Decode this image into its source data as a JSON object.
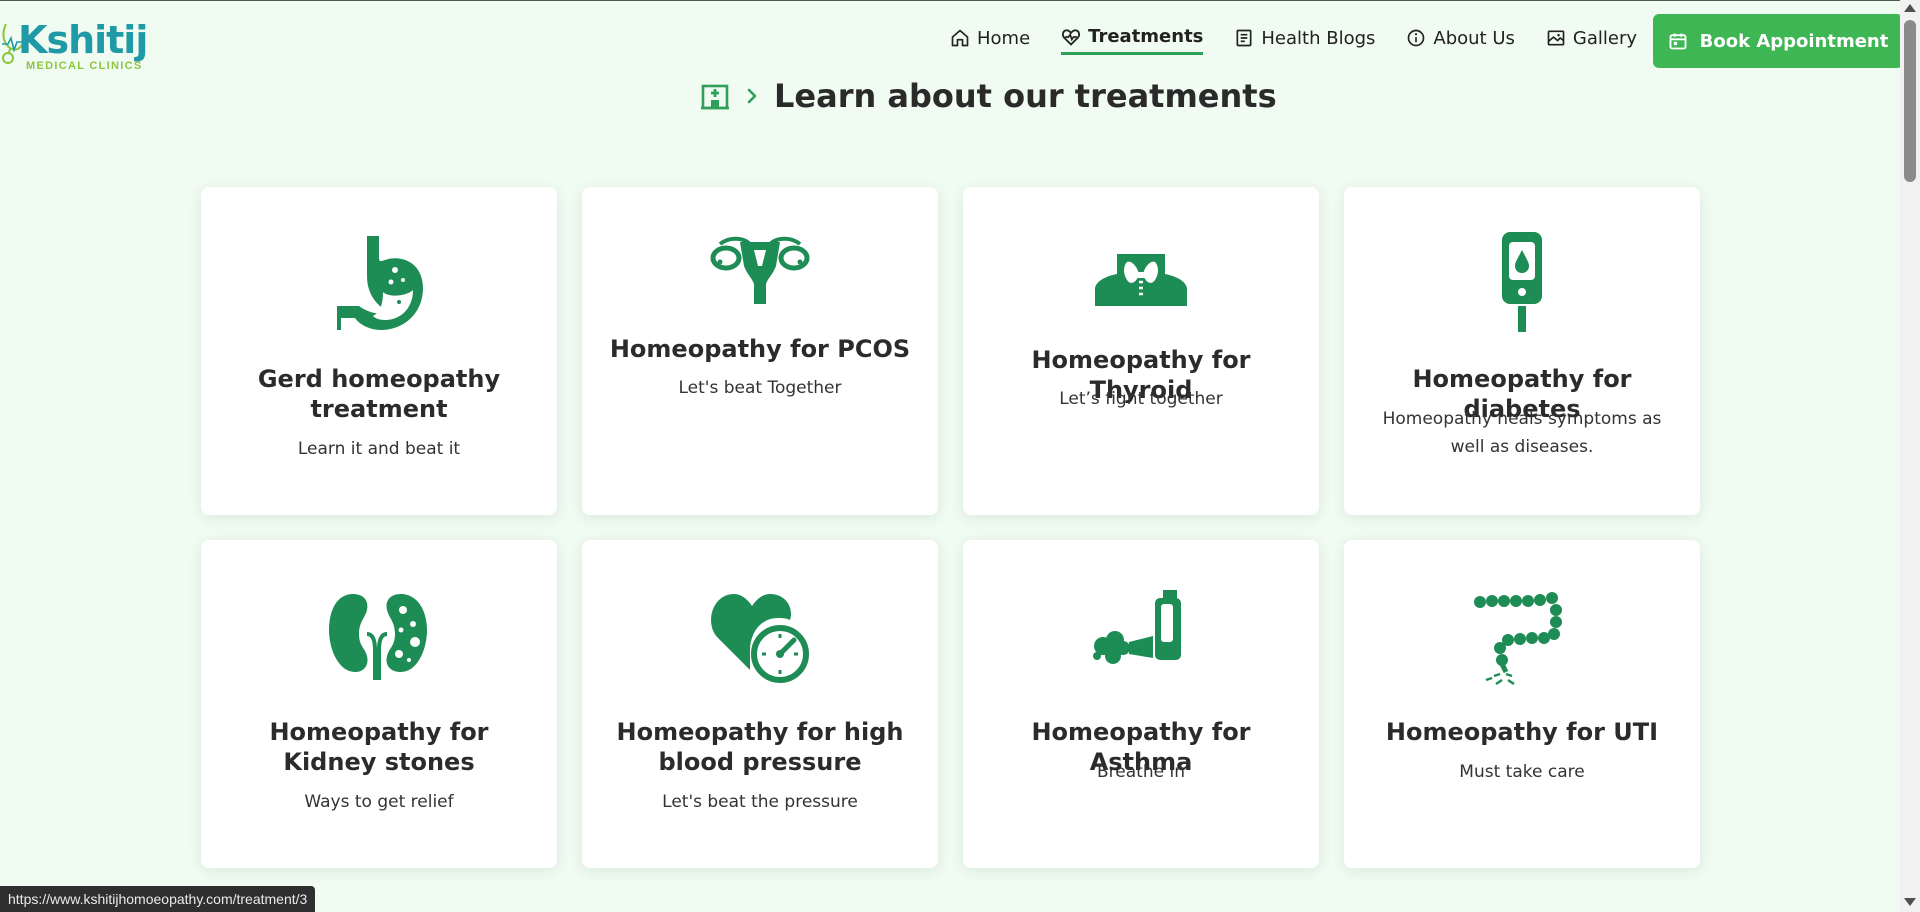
{
  "header": {
    "logo": {
      "name": "Kshitij",
      "subtitle": "MEDICAL CLINICS"
    },
    "nav": [
      {
        "label": "Home",
        "icon": "home-icon"
      },
      {
        "label": "Treatments",
        "icon": "heart-pulse-icon",
        "active": true
      },
      {
        "label": "Health Blogs",
        "icon": "document-icon"
      },
      {
        "label": "About Us",
        "icon": "info-icon"
      },
      {
        "label": "Gallery",
        "icon": "gallery-icon"
      }
    ],
    "cta": {
      "label": "Book Appointment",
      "icon": "calendar-icon"
    }
  },
  "page": {
    "title": "Learn about our treatments",
    "icon": "hospital-icon"
  },
  "treatments": [
    {
      "title": "Gerd homeopathy treatment",
      "subtitle": "Learn it and beat it",
      "icon": "stomach-icon"
    },
    {
      "title": "Homeopathy for PCOS",
      "subtitle": "Let's beat Together",
      "icon": "uterus-icon"
    },
    {
      "title": "Homeopathy for Thyroid",
      "subtitle": "Let’s fight together",
      "icon": "thyroid-icon"
    },
    {
      "title": "Homeopathy for diabetes",
      "subtitle": "Homeopathy heals symptoms as well as diseases.",
      "icon": "glucometer-icon"
    },
    {
      "title": "Homeopathy for Kidney stones",
      "subtitle": "Ways to get relief",
      "icon": "kidney-icon"
    },
    {
      "title": "Homeopathy for high blood pressure",
      "subtitle": "Let's beat the pressure",
      "icon": "heart-gauge-icon"
    },
    {
      "title": "Homeopathy for Asthma",
      "subtitle": "Breathe in",
      "icon": "inhaler-icon"
    },
    {
      "title": "Homeopathy for UTI",
      "subtitle": "Must take care",
      "icon": "intestine-icon"
    }
  ],
  "status_bar": {
    "url": "https://www.kshitijhomoeopathy.com/treatment/3"
  },
  "colors": {
    "brand_green": "#1e8c55",
    "button_green": "#3fb654",
    "logo_teal": "#1f9aa6",
    "background": "#f0fbf2"
  }
}
